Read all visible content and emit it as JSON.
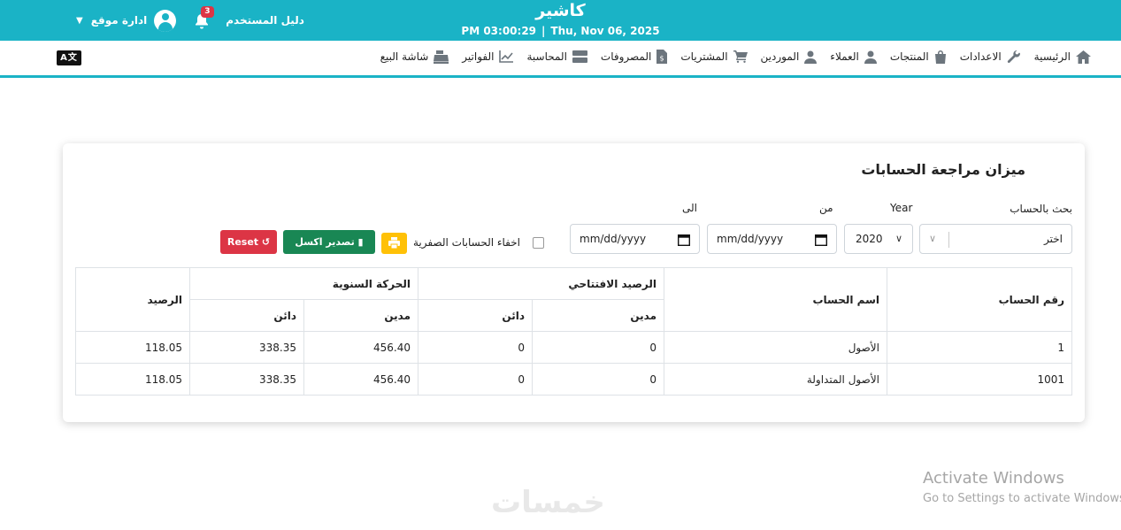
{
  "header": {
    "app_title": "كاشير",
    "time": "PM 03:00:29",
    "separator": "|",
    "date": "Thu, Nov 06, 2025",
    "user_guide": "دليل المستخدم",
    "notifications_count": "3",
    "admin_menu": "ادارة موقع",
    "accent_color": "#1ab3c6"
  },
  "nav": {
    "items": [
      {
        "label": "الرئيسية",
        "icon": "home-icon"
      },
      {
        "label": "الاعدادات",
        "icon": "wrench-icon"
      },
      {
        "label": "المنتجات",
        "icon": "bag-icon"
      },
      {
        "label": "العملاء",
        "icon": "user-icon"
      },
      {
        "label": "الموردين",
        "icon": "user-icon"
      },
      {
        "label": "المشتريات",
        "icon": "cart-icon"
      },
      {
        "label": "المصروفات",
        "icon": "money-file-icon"
      },
      {
        "label": "المحاسبة",
        "icon": "server-icon"
      },
      {
        "label": "الفواتير",
        "icon": "chart-icon"
      },
      {
        "label": "شاشة البيع",
        "icon": "cash-register-icon"
      }
    ],
    "language_toggle": "A文"
  },
  "report": {
    "title": "ميزان مراجعة الحسابات",
    "filters": {
      "account_label": "بحث بالحساب",
      "account_value": "اختر",
      "year_label": "Year",
      "year_value": "2020",
      "from_label": "من",
      "from_value": "mm/dd/yyyy",
      "to_label": "الى",
      "to_value": "mm/dd/yyyy",
      "hide_zero_label": "اخفاء الحسابات الصفرية"
    },
    "buttons": {
      "export_excel": "تصدير اكسل",
      "reset": "Reset"
    },
    "table": {
      "headers": {
        "account_number": "رقم الحساب",
        "account_name": "اسم الحساب",
        "opening_balance": "الرصيد الافتتاحي",
        "annual_movement": "الحركة السنوية",
        "balance": "الرصيد",
        "debit": "مدين",
        "credit": "دائن"
      },
      "rows": [
        {
          "number": "1",
          "name": "الأصول",
          "opening_debit": "0",
          "opening_credit": "0",
          "movement_debit": "456.40",
          "movement_credit": "338.35",
          "balance": "118.05"
        },
        {
          "number": "1001",
          "name": "الأصول المتداولة",
          "opening_debit": "0",
          "opening_credit": "0",
          "movement_debit": "456.40",
          "movement_credit": "338.35",
          "balance": "118.05"
        }
      ]
    }
  },
  "watermarks": {
    "activate_title": "Activate Windows",
    "activate_sub": "Go to Settings to activate Windows.",
    "brand": "خمسات"
  }
}
